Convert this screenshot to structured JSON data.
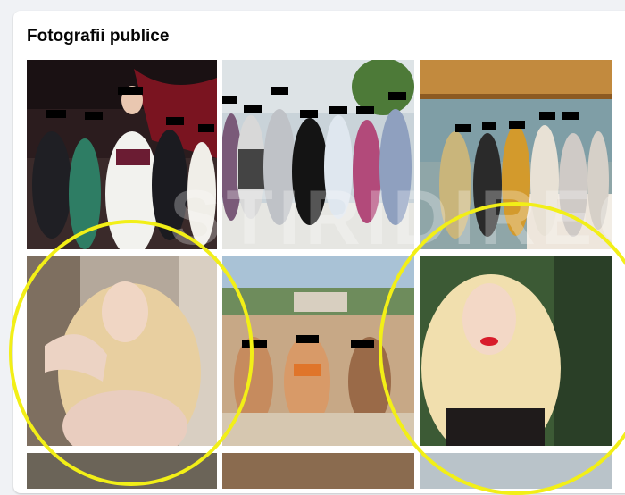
{
  "section": {
    "title": "Fotografii publice"
  },
  "watermark": {
    "text": "STIRIDIRECT"
  },
  "colors": {
    "highlight_circle": "#f2ef17",
    "censor_bar": "#000000",
    "page_background": "#f0f2f5",
    "card_background": "#ffffff"
  },
  "photos": [
    {
      "subject": "stage-group-photo"
    },
    {
      "subject": "group-photo-outdoor"
    },
    {
      "subject": "terrace-group-photo"
    },
    {
      "subject": "blonde-woman-portrait-1"
    },
    {
      "subject": "beach-group-photo"
    },
    {
      "subject": "blonde-woman-portrait-2"
    }
  ]
}
